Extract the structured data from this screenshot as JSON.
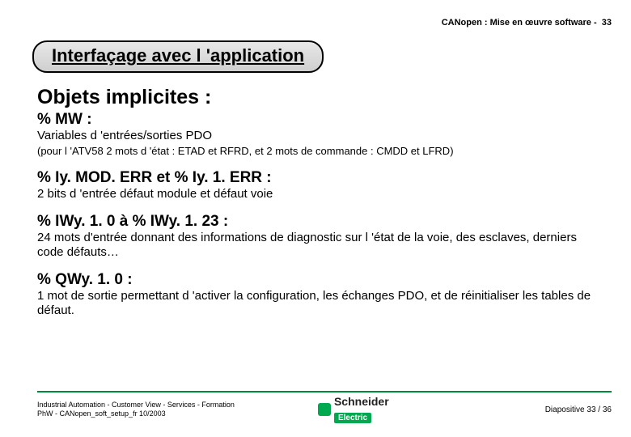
{
  "header": {
    "doc_title": "CANopen : Mise en œuvre software -",
    "page_no": "33"
  },
  "title_pill": "Interfaçage avec l 'application",
  "main_heading": "Objets implicites :",
  "sections": [
    {
      "heading": "% MW :",
      "desc": "Variables d 'entrées/sorties PDO",
      "small": "(pour l 'ATV58 2 mots d 'état : ETAD et RFRD, et 2 mots de commande : CMDD et LFRD)"
    },
    {
      "heading": "% Iy. MOD. ERR et % Iy. 1. ERR :",
      "desc": " 2 bits d 'entrée défaut module et défaut voie"
    },
    {
      "heading": "% IWy. 1. 0 à % IWy. 1. 23 :",
      "desc": "24 mots d'entrée donnant des informations de diagnostic sur l 'état de la voie, des esclaves, derniers code défauts…"
    },
    {
      "heading": "% QWy. 1. 0 :",
      "desc": "1 mot de sortie permettant d 'activer la configuration, les échanges PDO, et de réinitialiser les tables de défaut."
    }
  ],
  "footer": {
    "line1": "Industrial Automation - Customer View - Services - Formation",
    "line2": "PhW - CANopen_soft_setup_fr  10/2003",
    "slide": "Diapositive 33 / 36",
    "logo_brand": "Schneider",
    "logo_sub": "Electric"
  }
}
